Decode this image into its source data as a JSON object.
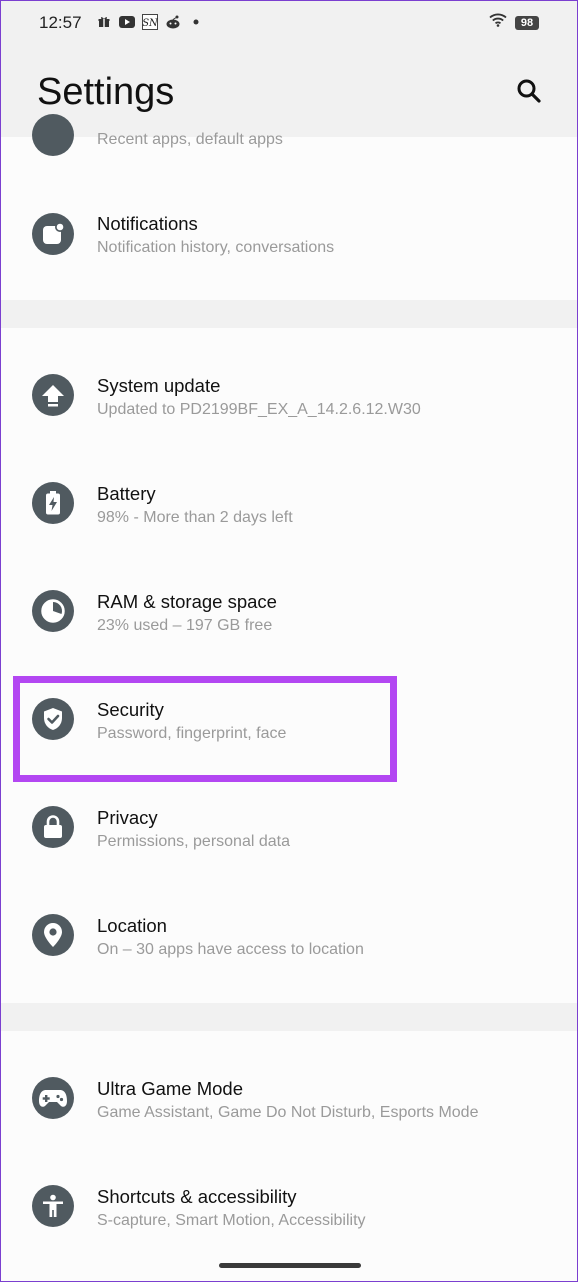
{
  "status_bar": {
    "time": "12:57",
    "icons": [
      "gift-icon",
      "youtube-icon",
      "sn-icon",
      "reddit-icon",
      "dot-icon"
    ],
    "battery": "98"
  },
  "header": {
    "title": "Settings",
    "search_icon": "search-icon"
  },
  "sections": [
    {
      "items": [
        {
          "title": "",
          "subtitle": "Recent apps, default apps",
          "icon": "apps-icon"
        },
        {
          "title": "Notifications",
          "subtitle": "Notification history, conversations",
          "icon": "notification-icon"
        }
      ]
    },
    {
      "items": [
        {
          "title": "System update",
          "subtitle": "Updated to PD2199BF_EX_A_14.2.6.12.W30",
          "icon": "update-arrow-icon"
        },
        {
          "title": "Battery",
          "subtitle": "98% - More than 2 days left",
          "icon": "battery-icon"
        },
        {
          "title": "RAM & storage space",
          "subtitle": "23% used – 197 GB free",
          "icon": "storage-pie-icon"
        },
        {
          "title": "Security",
          "subtitle": "Password, fingerprint, face",
          "icon": "shield-icon",
          "highlighted": true
        },
        {
          "title": "Privacy",
          "subtitle": "Permissions, personal data",
          "icon": "lock-icon"
        },
        {
          "title": "Location",
          "subtitle": "On – 30 apps have access to location",
          "icon": "location-pin-icon"
        }
      ]
    },
    {
      "items": [
        {
          "title": "Ultra Game Mode",
          "subtitle": "Game Assistant, Game Do Not Disturb, Esports Mode",
          "icon": "gamepad-icon"
        },
        {
          "title": "Shortcuts & accessibility",
          "subtitle": "S-capture, Smart Motion, Accessibility",
          "icon": "accessibility-icon"
        }
      ]
    }
  ],
  "colors": {
    "background": "#f1f1f1",
    "card": "#fcfcfc",
    "icon_circle": "#505a60",
    "subtitle": "#9a9a9a",
    "highlight": "#b347f2"
  }
}
